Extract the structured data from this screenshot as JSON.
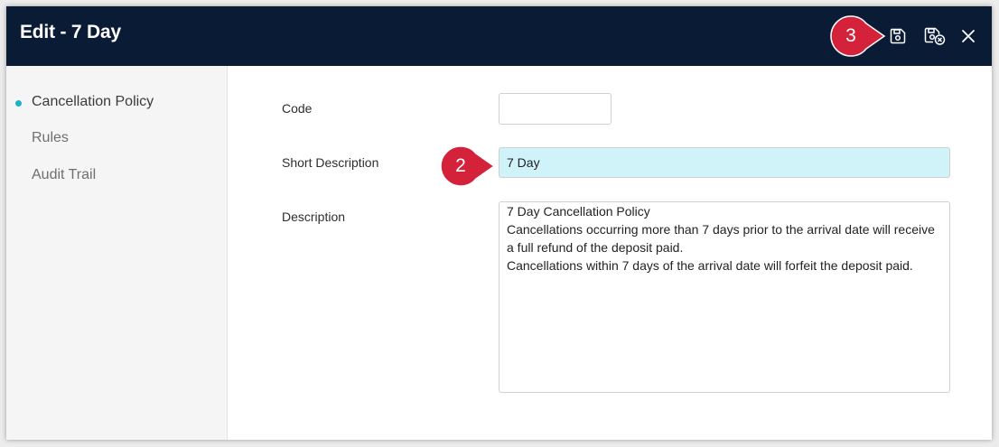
{
  "dialog": {
    "title": "Edit - 7 Day",
    "icons": {
      "save": "save-icon",
      "save_close": "save-close-icon",
      "close": "close-icon"
    },
    "colors": {
      "header": "#0a1b36",
      "accent": "#1cb1c6",
      "highlight_field": "#cff3f9",
      "callout": "#d3223a"
    }
  },
  "sidebar": {
    "items": [
      {
        "label": "Cancellation Policy",
        "active": true
      },
      {
        "label": "Rules",
        "active": false
      },
      {
        "label": "Audit Trail",
        "active": false
      }
    ]
  },
  "form": {
    "code": {
      "label": "Code",
      "value": ""
    },
    "short_description": {
      "label": "Short Description",
      "value": "7 Day"
    },
    "description": {
      "label": "Description",
      "value": "7 Day Cancellation Policy\nCancellations occurring more than 7 days prior to the arrival date will receive a full refund of the deposit paid.\nCancellations within 7 days of the arrival date will forfeit the deposit paid."
    }
  },
  "callouts": [
    {
      "number": "3",
      "target": "save-button"
    },
    {
      "number": "2",
      "target": "short-description-input"
    }
  ]
}
